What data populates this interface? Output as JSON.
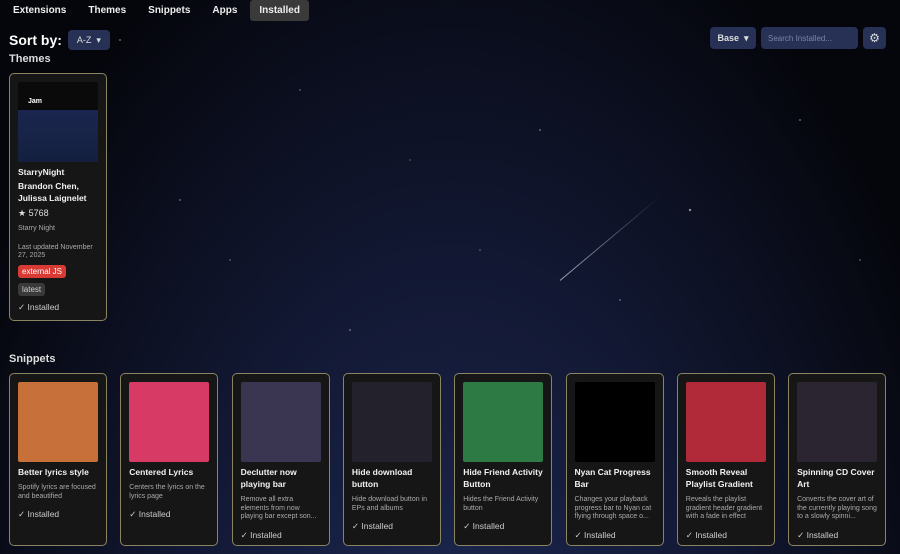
{
  "tabs": [
    "Extensions",
    "Themes",
    "Snippets",
    "Apps",
    "Installed"
  ],
  "active_tab": "Installed",
  "sort": {
    "label": "Sort by:",
    "value": "A-Z"
  },
  "toolbar": {
    "base_label": "Base",
    "search_placeholder": "Search Installed...",
    "settings_icon": "gear-icon"
  },
  "sections": {
    "themes": "Themes",
    "snippets": "Snippets"
  },
  "theme": {
    "thumb_text": "Jam",
    "title": "StarryNight",
    "authors": "Brandon Chen, Julissa Laignelet",
    "stars": "5768",
    "description": "Starry Night",
    "updated": "Last updated November 27, 2025",
    "badges": [
      "external JS",
      "latest"
    ],
    "status": "✓ Installed",
    "colors": {
      "external": "#d83a34",
      "latest": "#3a3a3a"
    }
  },
  "snippets": [
    {
      "title": "Better lyrics style",
      "desc": "Spotify lyrics are focused and beautified",
      "status": "✓ Installed",
      "color": "#c8703a"
    },
    {
      "title": "Centered Lyrics",
      "desc": "Centers the lyrics on the lyrics page",
      "status": "✓ Installed",
      "color": "#d83a66"
    },
    {
      "title": "Declutter now playing bar",
      "desc": "Remove all extra elements from now playing bar except son...",
      "status": "✓ Installed",
      "color": "#3a3550"
    },
    {
      "title": "Hide download button",
      "desc": "Hide download button in EPs and albums",
      "status": "✓ Installed",
      "color": "#22212c"
    },
    {
      "title": "Hide Friend Activity Button",
      "desc": "Hides the Friend Activity button",
      "status": "✓ Installed",
      "color": "#2e7a45"
    },
    {
      "title": "Nyan Cat Progress Bar",
      "desc": "Changes your playback progress bar to Nyan cat flying through space o...",
      "status": "✓ Installed",
      "color": "#000000"
    },
    {
      "title": "Smooth Reveal Playlist Gradient",
      "desc": "Reveals the playlist gradient header gradient with a fade in effect",
      "status": "✓ Installed",
      "color": "#b02a3a"
    },
    {
      "title": "Spinning CD Cover Art",
      "desc": "Converts the cover art of the currently playing song to a slowly spinni...",
      "status": "✓ Installed",
      "color": "#2a2530"
    }
  ]
}
